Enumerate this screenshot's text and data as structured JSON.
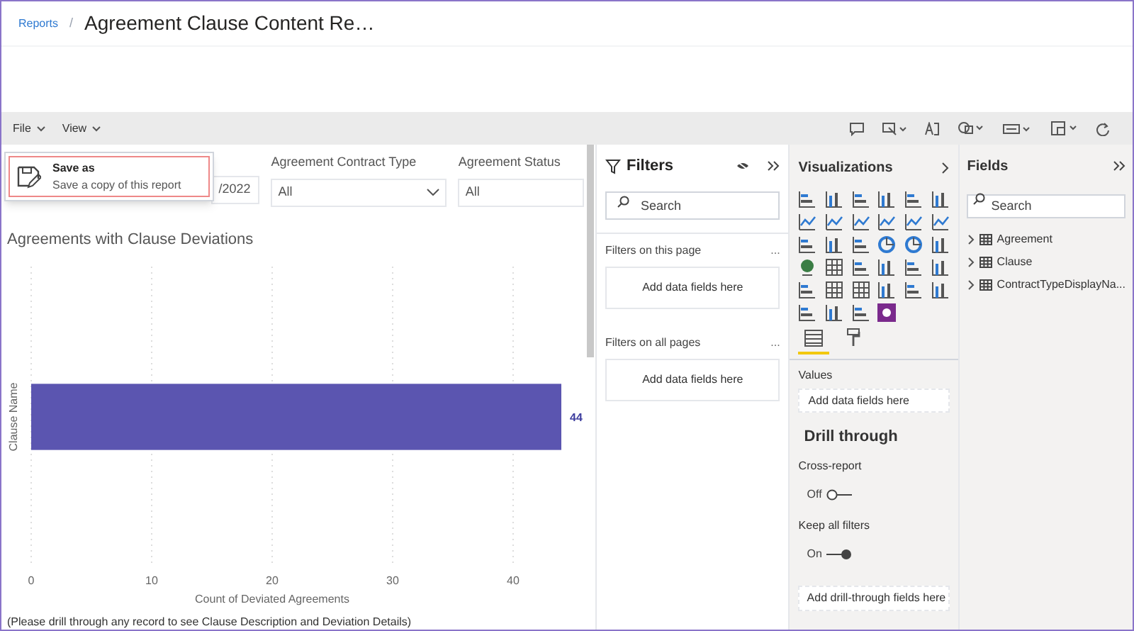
{
  "header": {
    "breadcrumb": "Reports",
    "separator": "/",
    "title": "Agreement Clause Content Re…"
  },
  "menu": [
    {
      "label": "File"
    },
    {
      "label": "View"
    }
  ],
  "save_as_popup": {
    "title": "Save as",
    "description": "Save a copy of this report"
  },
  "slicers": [
    {
      "value": "/2022"
    },
    {
      "label": "Agreement Contract Type",
      "value": "All"
    },
    {
      "label": "Agreement Status",
      "value": "All"
    }
  ],
  "chart": {
    "chart_data": {
      "type": "bar",
      "orientation": "horizontal",
      "title": "Agreements with Clause Deviations",
      "xlabel": "Count of Deviated Agreements",
      "ylabel": "Clause Name",
      "values": [
        44
      ],
      "xlim": [
        0,
        44
      ],
      "xticks": [
        0,
        10,
        20,
        30,
        40
      ],
      "grid": true,
      "data_labels": true
    }
  },
  "footnote": "(Please drill through any record to see Clause Description and Deviation Details)",
  "filters": {
    "title": "Filters",
    "search_placeholder": "Search",
    "sections": [
      {
        "title": "Filters on this page",
        "menu": "...",
        "drop": "Add data fields here"
      },
      {
        "title": "Filters on all pages",
        "menu": "...",
        "drop": "Add data fields here"
      }
    ]
  },
  "visualizations": {
    "title": "Visualizations",
    "tabs": [
      {
        "kind": "fields",
        "selected": true
      },
      {
        "kind": "format",
        "selected": false
      }
    ],
    "values_label": "Values",
    "values_drop": "Add data fields here",
    "drill_through": {
      "title": "Drill through",
      "toggles": [
        {
          "label": "Cross-report",
          "state_text": "Off",
          "on": false
        },
        {
          "label": "Keep all filters",
          "state_text": "On",
          "on": true
        }
      ],
      "drop": "Add drill-through fields here"
    }
  },
  "fields": {
    "title": "Fields",
    "search_placeholder": "Search",
    "items": [
      {
        "label": "Agreement",
        "expanded": false
      },
      {
        "label": "Clause",
        "expanded": false
      },
      {
        "label": "ContractTypeDisplayNa...",
        "expanded": false
      }
    ]
  }
}
